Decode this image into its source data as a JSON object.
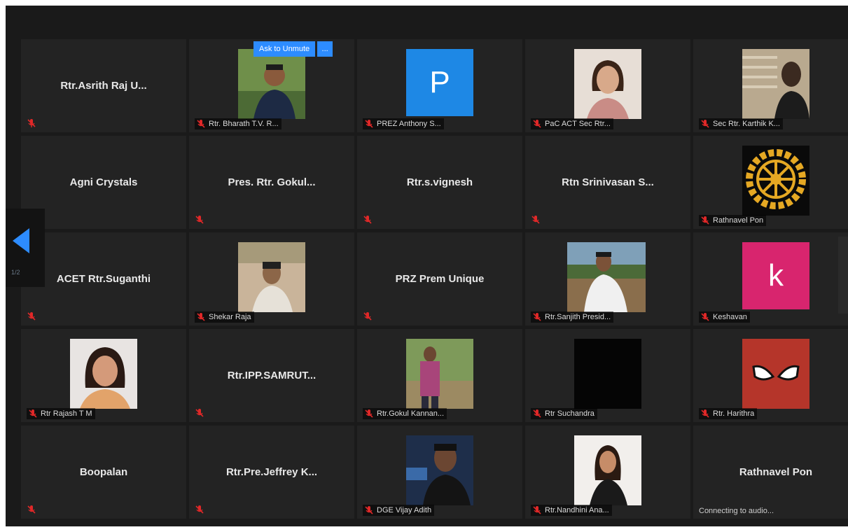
{
  "window": {
    "accent": "#2d8cff",
    "background": "#1a1a1a",
    "tile_background": "#232323"
  },
  "nav": {
    "prev_icon": "chevron-left-icon",
    "page_indicator": "1/2"
  },
  "tiles": [
    {
      "name": "Rtr.Asrith Raj U...",
      "label": "",
      "status": ""
    },
    {
      "name": "",
      "label": "Rtr. Bharath T.V. R...",
      "status": "",
      "ask_to_unmute": "Ask to Unmute",
      "more": "..."
    },
    {
      "name": "",
      "label": "PREZ Anthony S...",
      "status": "",
      "letter": "P",
      "letter_color": "#1e88e5"
    },
    {
      "name": "",
      "label": "PaC ACT Sec Rtr...",
      "status": ""
    },
    {
      "name": "",
      "label": "Sec Rtr. Karthik K...",
      "status": ""
    },
    {
      "name": "Agni Crystals",
      "label": "",
      "status": ""
    },
    {
      "name": "Pres. Rtr. Gokul...",
      "label": "",
      "status": ""
    },
    {
      "name": "Rtr.s.vignesh",
      "label": "",
      "status": ""
    },
    {
      "name": "Rtn Srinivasan S...",
      "label": "",
      "status": ""
    },
    {
      "name": "",
      "label": "Rathnavel Pon",
      "status": ""
    },
    {
      "name": "ACET Rtr.Suganthi",
      "label": "",
      "status": ""
    },
    {
      "name": "",
      "label": "Shekar Raja",
      "status": ""
    },
    {
      "name": "PRZ Prem Unique",
      "label": "",
      "status": ""
    },
    {
      "name": "",
      "label": "Rtr.Sanjith Presid...",
      "status": ""
    },
    {
      "name": "",
      "label": "Keshavan",
      "status": "",
      "letter": "k",
      "letter_color": "#d8256e"
    },
    {
      "name": "",
      "label": "Rtr Rajash T M",
      "status": ""
    },
    {
      "name": "Rtr.IPP.SAMRUT...",
      "label": "",
      "status": ""
    },
    {
      "name": "",
      "label": "Rtr.Gokul Kannan...",
      "status": ""
    },
    {
      "name": "",
      "label": "Rtr Suchandra",
      "status": ""
    },
    {
      "name": "",
      "label": "Rtr. Harithra",
      "status": ""
    },
    {
      "name": "Boopalan",
      "label": "",
      "status": ""
    },
    {
      "name": "Rtr.Pre.Jeffrey K...",
      "label": "",
      "status": ""
    },
    {
      "name": "",
      "label": "DGE Vijay Adith",
      "status": ""
    },
    {
      "name": "",
      "label": "Rtr.Nandhini Ana...",
      "status": ""
    },
    {
      "name": "Rathnavel Pon",
      "label": "",
      "status": "Connecting to audio..."
    }
  ]
}
